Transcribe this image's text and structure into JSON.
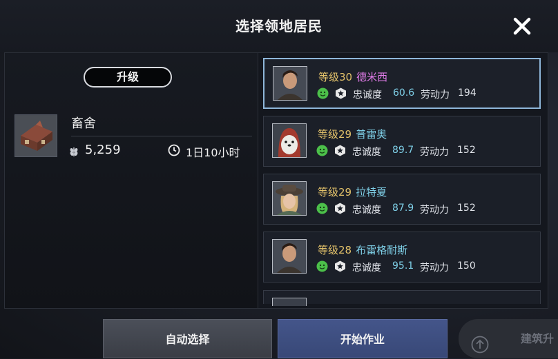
{
  "header": {
    "title": "选择领地居民"
  },
  "building": {
    "upgrade_label": "升级",
    "name": "畜舍",
    "resource_value": "5,259",
    "time": "1日10小时"
  },
  "residents": [
    {
      "level": "等级30",
      "name": "德米西",
      "name_color": "#e07be8",
      "loyalty_label": "忠诚度",
      "loyalty": "60.6",
      "labor_label": "劳动力",
      "labor": "194",
      "selected": true,
      "portrait": "man"
    },
    {
      "level": "等级29",
      "name": "普雷奥",
      "name_color": "#7fd0e8",
      "loyalty_label": "忠诚度",
      "loyalty": "89.7",
      "labor_label": "劳动力",
      "labor": "152",
      "selected": false,
      "portrait": "seal"
    },
    {
      "level": "等级29",
      "name": "拉特夏",
      "name_color": "#7fd0e8",
      "loyalty_label": "忠诚度",
      "loyalty": "87.9",
      "labor_label": "劳动力",
      "labor": "152",
      "selected": false,
      "portrait": "woman"
    },
    {
      "level": "等级28",
      "name": "布雷格耐斯",
      "name_color": "#7fd0e8",
      "loyalty_label": "忠诚度",
      "loyalty": "95.1",
      "labor_label": "劳动力",
      "labor": "150",
      "selected": false,
      "portrait": "man"
    }
  ],
  "footer": {
    "auto_label": "自动选择",
    "start_label": "开始作业",
    "build_label": "建筑升"
  },
  "colors": {
    "level": "#e3c26a",
    "loyalty_value": "#7fd0e8",
    "selection_border": "#8fb7da",
    "start_button": "#3f4f84"
  }
}
